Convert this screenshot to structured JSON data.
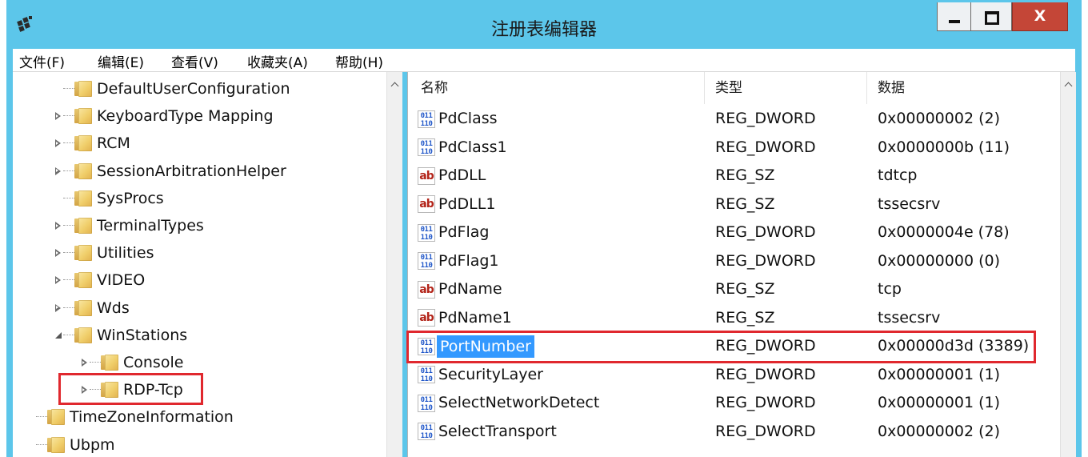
{
  "window": {
    "title": "注册表编辑器",
    "min_glyph": "",
    "max_glyph": "",
    "close_glyph": "X"
  },
  "menu": [
    "文件(F)",
    "编辑(E)",
    "查看(V)",
    "收藏夹(A)",
    "帮助(H)"
  ],
  "tree": [
    {
      "label": "DefaultUserConfiguration",
      "expander": "none",
      "level": 1
    },
    {
      "label": "KeyboardType Mapping",
      "expander": "collapsed",
      "level": 1
    },
    {
      "label": "RCM",
      "expander": "collapsed",
      "level": 1
    },
    {
      "label": "SessionArbitrationHelper",
      "expander": "collapsed",
      "level": 1
    },
    {
      "label": "SysProcs",
      "expander": "none",
      "level": 1
    },
    {
      "label": "TerminalTypes",
      "expander": "collapsed",
      "level": 1
    },
    {
      "label": "Utilities",
      "expander": "collapsed",
      "level": 1
    },
    {
      "label": "VIDEO",
      "expander": "collapsed",
      "level": 1
    },
    {
      "label": "Wds",
      "expander": "collapsed",
      "level": 1
    },
    {
      "label": "WinStations",
      "expander": "expanded",
      "level": 1
    },
    {
      "label": "Console",
      "expander": "collapsed",
      "level": 2
    },
    {
      "label": "RDP-Tcp",
      "expander": "collapsed",
      "level": 2,
      "highlighted": true
    },
    {
      "label": "TimeZoneInformation",
      "expander": "none",
      "level": 0
    },
    {
      "label": "Ubpm",
      "expander": "none",
      "level": 0
    }
  ],
  "columns": {
    "name": "名称",
    "type": "类型",
    "data": "数据"
  },
  "values": [
    {
      "name": "PdClass",
      "type": "REG_DWORD",
      "data": "0x00000002 (2)",
      "icon": "dword"
    },
    {
      "name": "PdClass1",
      "type": "REG_DWORD",
      "data": "0x0000000b (11)",
      "icon": "dword"
    },
    {
      "name": "PdDLL",
      "type": "REG_SZ",
      "data": "tdtcp",
      "icon": "sz"
    },
    {
      "name": "PdDLL1",
      "type": "REG_SZ",
      "data": "tssecsrv",
      "icon": "sz"
    },
    {
      "name": "PdFlag",
      "type": "REG_DWORD",
      "data": "0x0000004e (78)",
      "icon": "dword"
    },
    {
      "name": "PdFlag1",
      "type": "REG_DWORD",
      "data": "0x00000000 (0)",
      "icon": "dword"
    },
    {
      "name": "PdName",
      "type": "REG_SZ",
      "data": "tcp",
      "icon": "sz"
    },
    {
      "name": "PdName1",
      "type": "REG_SZ",
      "data": "tssecsrv",
      "icon": "sz"
    },
    {
      "name": "PortNumber",
      "type": "REG_DWORD",
      "data": "0x00000d3d (3389)",
      "icon": "dword",
      "selected": true
    },
    {
      "name": "SecurityLayer",
      "type": "REG_DWORD",
      "data": "0x00000001 (1)",
      "icon": "dword"
    },
    {
      "name": "SelectNetworkDetect",
      "type": "REG_DWORD",
      "data": "0x00000001 (1)",
      "icon": "dword"
    },
    {
      "name": "SelectTransport",
      "type": "REG_DWORD",
      "data": "0x00000002 (2)",
      "icon": "dword"
    }
  ],
  "icons": {
    "dword": "binary-value-icon",
    "sz": "string-value-icon",
    "folder": "folder-icon"
  },
  "colors": {
    "titlebar": "#5cc6ea",
    "selection": "#3399ff",
    "highlight_box": "#e0282e",
    "close_button": "#c44637"
  }
}
